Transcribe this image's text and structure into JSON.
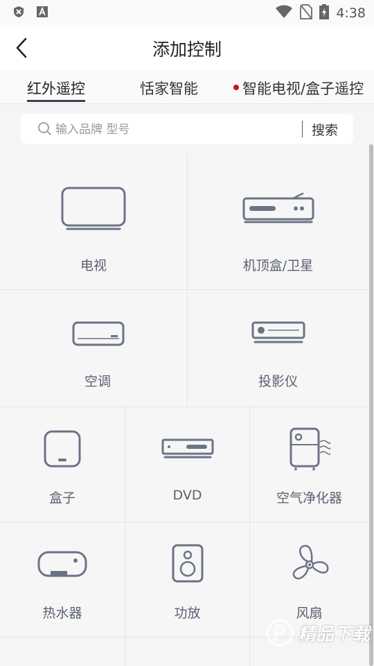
{
  "status_bar": {
    "time": "4:38",
    "left_icons": [
      "shield-x-icon",
      "font-a-icon"
    ],
    "right_icons": [
      "wifi-icon",
      "no-sim-icon",
      "battery-charging-icon"
    ]
  },
  "header": {
    "title": "添加控制",
    "back_icon": "chevron-left-icon"
  },
  "tabs": [
    {
      "label": "红外遥控",
      "active": true
    },
    {
      "label": "恬家智能",
      "active": false
    },
    {
      "label": "智能电视/盒子遥控",
      "active": false,
      "dot": true
    }
  ],
  "search": {
    "placeholder": "输入品牌 型号",
    "value": "",
    "button_label": "搜索"
  },
  "devices": [
    {
      "label": "电视",
      "icon": "tv-icon"
    },
    {
      "label": "机顶盒/卫星",
      "icon": "set-top-box-icon"
    },
    {
      "label": "空调",
      "icon": "air-conditioner-icon"
    },
    {
      "label": "投影仪",
      "icon": "projector-icon"
    },
    {
      "label": "盒子",
      "icon": "media-box-icon"
    },
    {
      "label": "DVD",
      "icon": "dvd-player-icon"
    },
    {
      "label": "空气净化器",
      "icon": "air-purifier-icon"
    },
    {
      "label": "热水器",
      "icon": "water-heater-icon"
    },
    {
      "label": "功放",
      "icon": "speaker-icon"
    },
    {
      "label": "风扇",
      "icon": "fan-icon"
    }
  ],
  "watermark": {
    "text": "精品下载"
  },
  "colors": {
    "icon_stroke": "#6b7385",
    "label": "#5a6070",
    "active_tab_underline": "#3a4252",
    "tab_dot": "#c8161d"
  }
}
